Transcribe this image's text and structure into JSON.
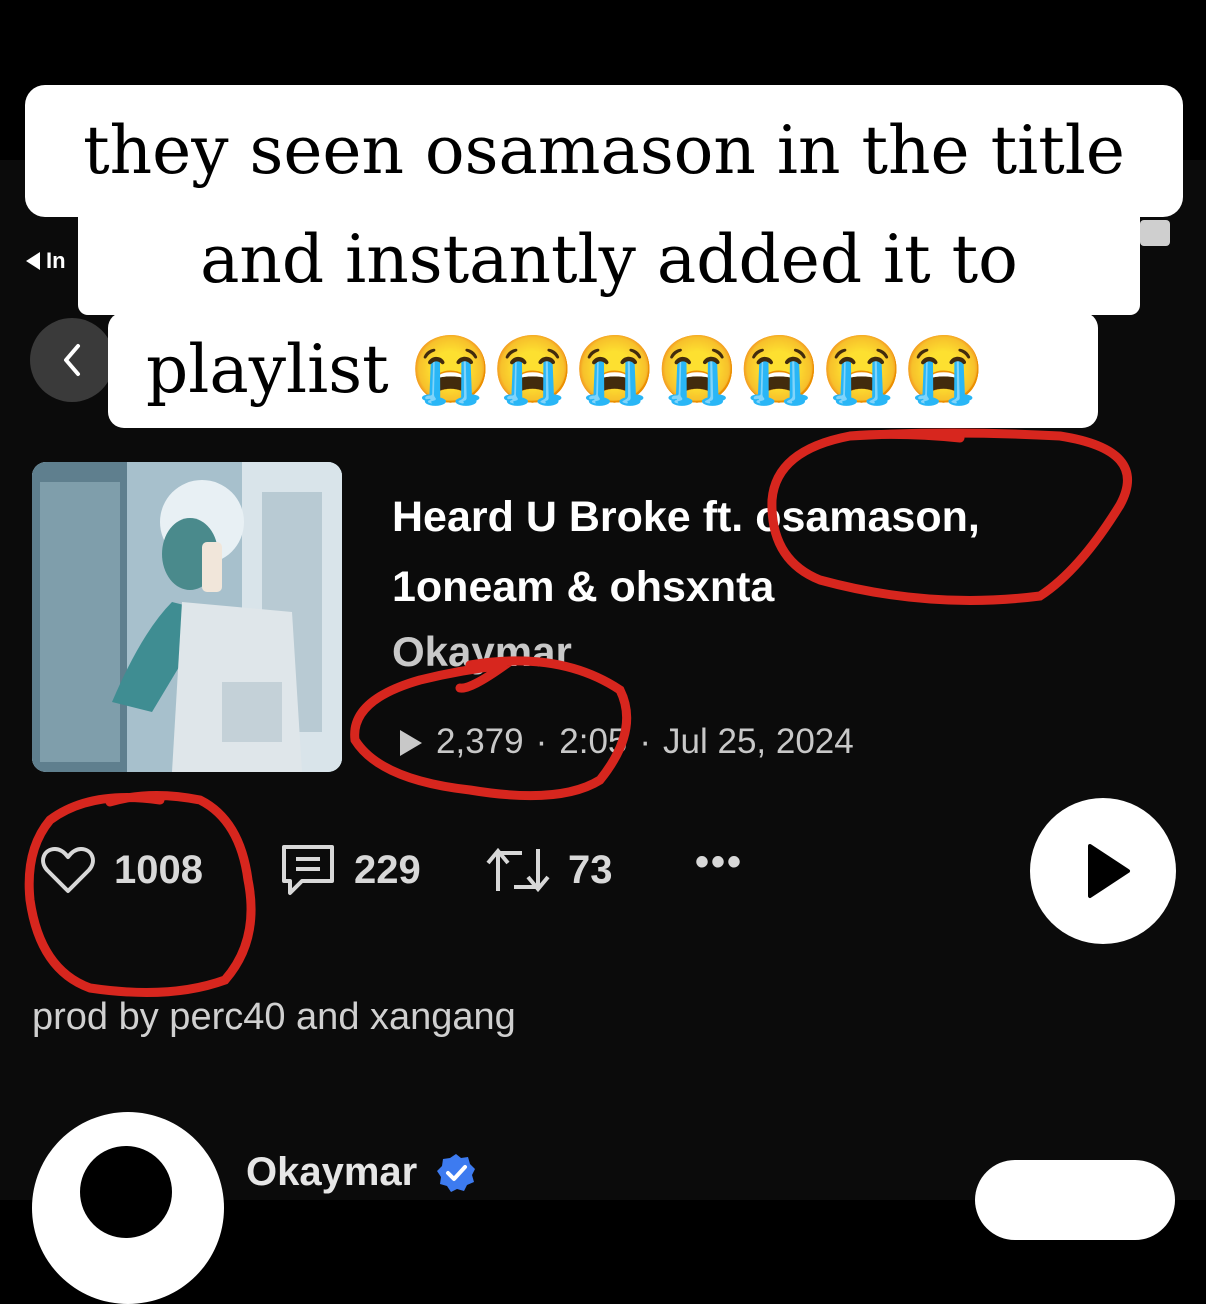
{
  "caption": {
    "line1": "they seen osamason in the title",
    "line2": "and instantly added it to",
    "line3": "playlist 😭😭😭😭😭😭😭"
  },
  "nav": {
    "back_hint_text": "In",
    "back_icon": "chevron-left-icon"
  },
  "track": {
    "title": "Heard U Broke ft. osamason, 1oneam & ohsxnta",
    "artist": "Okaymar",
    "plays": "2,379",
    "duration": "2:05",
    "date": "Jul 25, 2024",
    "separator": "·"
  },
  "stats": {
    "likes": "1008",
    "comments": "229",
    "reposts": "73",
    "more": "•••"
  },
  "description": "prod by perc40 and xangang",
  "uploader": {
    "name": "Okaymar",
    "verified_icon": "verified-badge-icon"
  },
  "colors": {
    "background": "#0b0b0b",
    "annotation_red": "#d7261e",
    "verified_blue": "#3d7bf0"
  }
}
